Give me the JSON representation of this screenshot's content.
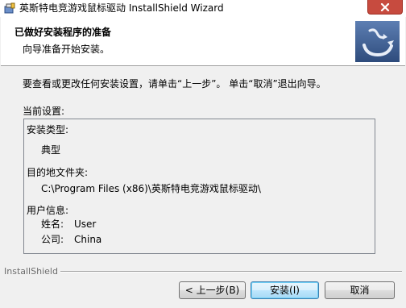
{
  "window": {
    "title": "英斯特电竞游戏鼠标驱动 InstallShield Wizard",
    "icons": {
      "app": "installer-icon",
      "close": "close-icon",
      "logo": "installshield-logo-icon"
    }
  },
  "header": {
    "title": "已做好安装程序的准备",
    "subtitle": "向导准备开始安装。"
  },
  "body": {
    "intro": "要查看或更改任何安装设置，请单击“上一步”。 单击“取消”退出向导。",
    "settings_label": "当前设置:",
    "settings": {
      "setup_type_label": "安装类型:",
      "setup_type_value": "典型",
      "destination_label": "目的地文件夹:",
      "destination_value": "C:\\Program Files (x86)\\英斯特电竞游戏鼠标驱动\\",
      "user_info_label": "用户信息:",
      "name_label": "姓名:",
      "name_value": "User",
      "company_label": "公司:",
      "company_value": "China"
    }
  },
  "footer": {
    "brand": "InstallShield",
    "back_label": "< 上一步(B)",
    "install_label": "安装(I)",
    "cancel_label": "取消"
  },
  "colors": {
    "close_button": "#c74b3f",
    "logo_background": "#3f5f8f",
    "default_button_border": "#3c7fb1"
  }
}
